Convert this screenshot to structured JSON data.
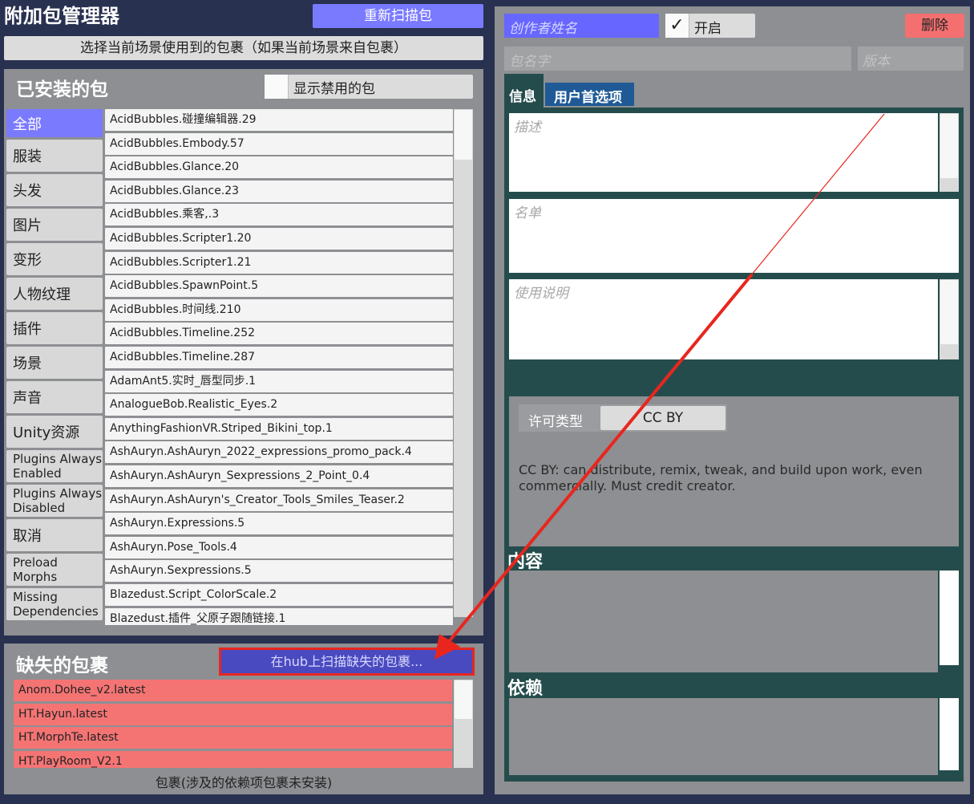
{
  "app_title": "附加包管理器",
  "rescan_button": "重新扫描包",
  "select_scene_button": "选择当前场景使用到的包裹（如果当前场景来自包裹）",
  "installed": {
    "title": "已安装的包",
    "show_disabled_label": "显示禁用的包",
    "categories": [
      "全部",
      "服装",
      "头发",
      "图片",
      "变形",
      "人物纹理",
      "插件",
      "场景",
      "声音",
      "Unity资源",
      "Plugins Always Enabled",
      "Plugins Always Disabled",
      "取消",
      "Preload Morphs",
      "Missing Dependencies"
    ],
    "packages": [
      "AcidBubbles.碰撞编辑器.29",
      "AcidBubbles.Embody.57",
      "AcidBubbles.Glance.20",
      "AcidBubbles.Glance.23",
      "AcidBubbles.乘客,.3",
      "AcidBubbles.Scripter1.20",
      "AcidBubbles.Scripter1.21",
      "AcidBubbles.SpawnPoint.5",
      "AcidBubbles.时间线.210",
      "AcidBubbles.Timeline.252",
      "AcidBubbles.Timeline.287",
      "AdamAnt5.实时_唇型同步.1",
      "AnalogueBob.Realistic_Eyes.2",
      "AnythingFashionVR.Striped_Bikini_top.1",
      "AshAuryn.AshAuryn_2022_expressions_promo_pack.4",
      "AshAuryn.AshAuryn_Sexpressions_2_Point_0.4",
      "AshAuryn.AshAuryn's_Creator_Tools_Smiles_Teaser.2",
      "AshAuryn.Expressions.5",
      "AshAuryn.Pose_Tools.4",
      "AshAuryn.Sexpressions.5",
      "Blazedust.Script_ColorScale.2",
      "Blazedust.插件_父原子跟随链接.1"
    ]
  },
  "missing": {
    "title": "缺失的包裹",
    "scan_hub_button": "在hub上扫描缺失的包裹...",
    "packages": [
      "Anom.Dohee_v2.latest",
      "HT.Hayun.latest",
      "HT.MorphTe.latest",
      "HT.PlayRoom_V2.1"
    ],
    "footer": "包裹(涉及的依赖项包裹未安装)"
  },
  "detail": {
    "creator_placeholder": "创作者姓名",
    "enabled_label": "开启",
    "enabled_checked": true,
    "delete_button": "删除",
    "package_name_placeholder": "包名字",
    "version_placeholder": "版本",
    "tabs": [
      "信息",
      "用户首选项"
    ],
    "description_placeholder": "描述",
    "credits_placeholder": "名单",
    "instructions_placeholder": "使用说明",
    "license_label": "许可类型",
    "license_value": "CC BY",
    "license_text": "CC BY: can distribute, remix, tweak, and build upon work, even commercially. Must credit creator.",
    "contents_title": "内容",
    "dependencies_title": "依赖"
  },
  "colors": {
    "background": "#293150",
    "accent_purple": "#7a7aff",
    "missing_red": "#f47474",
    "delete_red": "#f47070",
    "teal": "#254c4c",
    "tab_blue": "#1f5a96",
    "annotation_arrow": "#e8261e"
  }
}
